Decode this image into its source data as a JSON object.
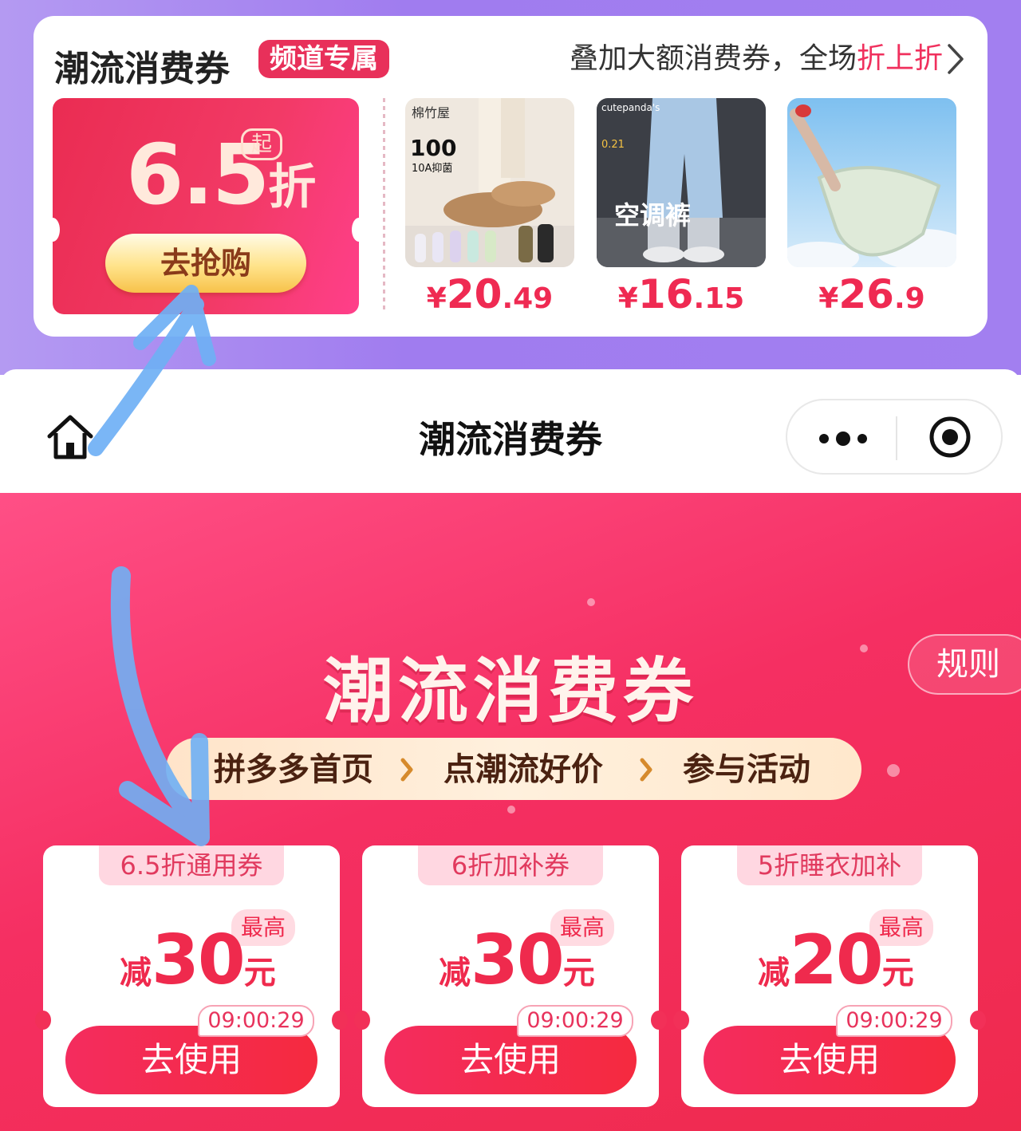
{
  "banner": {
    "title": "潮流消费券",
    "badge": "频道专属",
    "promo_prefix": "叠加大额消费券，全场",
    "promo_highlight": "折上折",
    "big_coupon": {
      "discount_number": "6.5",
      "discount_unit": "折",
      "from_label": "起",
      "button_label": "去抢购"
    },
    "products": [
      {
        "currency": "¥",
        "price_int": "20",
        "price_dec": ".49",
        "image_text": "棉竹屋",
        "image_sub": "100",
        "image_tag": "10A抑菌"
      },
      {
        "currency": "¥",
        "price_int": "16",
        "price_dec": ".15",
        "image_text": "cutepanda's",
        "image_sub": "0.21",
        "image_tag": "空调裤"
      },
      {
        "currency": "¥",
        "price_int": "26",
        "price_dec": ".9",
        "image_text": "",
        "image_sub": "",
        "image_tag": ""
      }
    ]
  },
  "nav": {
    "title": "潮流消费券"
  },
  "main": {
    "title": "潮流消费券",
    "rules_label": "规则",
    "steps": [
      "拼多多首页",
      "点潮流好价",
      "参与活动"
    ],
    "coupons": [
      {
        "tag": "6.5折通用券",
        "prefix": "减",
        "amount": "30",
        "unit": "元",
        "max_label": "最高",
        "timer": "09:00:29",
        "button": "去使用"
      },
      {
        "tag": "6折加补券",
        "prefix": "减",
        "amount": "30",
        "unit": "元",
        "max_label": "最高",
        "timer": "09:00:29",
        "button": "去使用"
      },
      {
        "tag": "5折睡衣加补",
        "prefix": "减",
        "amount": "20",
        "unit": "元",
        "max_label": "最高",
        "timer": "09:00:29",
        "button": "去使用"
      }
    ]
  },
  "colors": {
    "accent": "#ef2a4d",
    "top_bg": "#a07cef",
    "annotation_arrow": "#6fb0f5"
  }
}
